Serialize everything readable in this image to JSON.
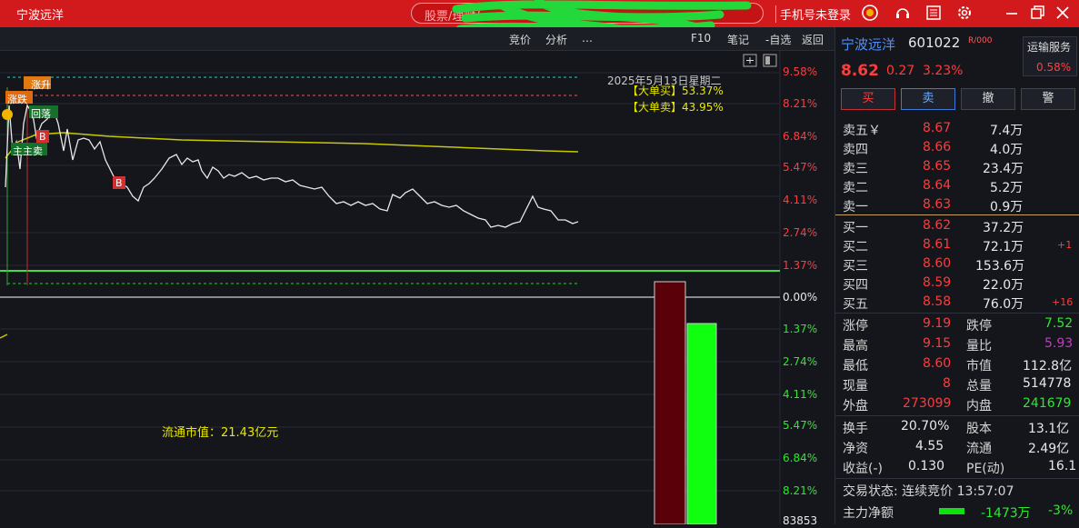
{
  "titlebar": {
    "title": "宁波远洋",
    "search_placeholder": "股票/理财/…",
    "login_label": "手机号未登录",
    "icons": [
      "gold-icon",
      "headset-icon",
      "notes-icon",
      "settings-icon",
      "minimize-icon",
      "restore-icon",
      "close-icon"
    ]
  },
  "toolbar": {
    "items": [
      "竞价",
      "分析",
      "…",
      "F10",
      "笔记",
      "-自选",
      "返回"
    ]
  },
  "chart": {
    "date_label": "2025年5月13日星期二",
    "big_buy_label": "【大单买】53.37%",
    "big_sell_label": "【大单卖】43.95%",
    "float_cap_label": "流通市值：21.43亿元",
    "markers": [
      "涨升",
      "涨跌",
      "回落",
      "B",
      "主主卖",
      "B"
    ],
    "right_axis_top": [
      "9.58%",
      "8.21%",
      "6.84%",
      "5.47%",
      "4.11%",
      "2.74%",
      "1.37%",
      "0.00%"
    ],
    "right_axis_bottom": [
      "1.37%",
      "2.74%",
      "4.11%",
      "5.47%",
      "6.84%",
      "8.21%",
      "83853"
    ],
    "colors": {
      "price_line": "#e8e8e8",
      "avg_line": "#c8c800",
      "sell_bar": "#5a0008",
      "buy_bar": "#0f0"
    }
  },
  "panel": {
    "name": "宁波远洋",
    "code": "601022",
    "sup": "R/000",
    "service_label": "运输服务",
    "service_pct": "0.58%",
    "price": "8.62",
    "change": "0.27",
    "change_pct": "3.23%",
    "trade_buttons": [
      "买",
      "卖",
      "撤",
      "警"
    ],
    "sell_rows": [
      {
        "label": "卖五￥",
        "price": "8.67",
        "vol": "7.4万",
        "delta": ""
      },
      {
        "label": "卖四",
        "price": "8.66",
        "vol": "4.0万",
        "delta": ""
      },
      {
        "label": "卖三",
        "price": "8.65",
        "vol": "23.4万",
        "delta": ""
      },
      {
        "label": "卖二",
        "price": "8.64",
        "vol": "5.2万",
        "delta": ""
      },
      {
        "label": "卖一",
        "price": "8.63",
        "vol": "0.9万",
        "delta": ""
      }
    ],
    "buy_rows": [
      {
        "label": "买一",
        "price": "8.62",
        "vol": "37.2万",
        "delta": ""
      },
      {
        "label": "买二",
        "price": "8.61",
        "vol": "72.1万",
        "delta": "+1"
      },
      {
        "label": "买三",
        "price": "8.60",
        "vol": "153.6万",
        "delta": ""
      },
      {
        "label": "买四",
        "price": "8.59",
        "vol": "22.0万",
        "delta": ""
      },
      {
        "label": "买五",
        "price": "8.58",
        "vol": "76.0万",
        "delta": "+16"
      }
    ],
    "stats": [
      {
        "l1": "涨停",
        "v1": "9.19",
        "c1": "red",
        "l2": "跌停",
        "v2": "7.52",
        "c2": "green"
      },
      {
        "l1": "最高",
        "v1": "9.15",
        "c1": "red",
        "l2": "量比",
        "v2": "5.93",
        "c2": "purple"
      },
      {
        "l1": "最低",
        "v1": "8.60",
        "c1": "red",
        "l2": "市值",
        "v2": "112.8亿",
        "c2": "white"
      },
      {
        "l1": "现量",
        "v1": "8",
        "c1": "red",
        "l2": "总量",
        "v2": "514778",
        "c2": "white"
      },
      {
        "l1": "外盘",
        "v1": "273099",
        "c1": "red",
        "l2": "内盘",
        "v2": "241679",
        "c2": "green"
      }
    ],
    "stats2": [
      {
        "l1": "换手",
        "v1": "20.70%",
        "l2": "股本",
        "v2": "13.1亿"
      },
      {
        "l1": "净资",
        "v1": "4.55",
        "l2": "流通",
        "v2": "2.49亿"
      },
      {
        "l1": "收益(-)",
        "v1": "0.130",
        "l2": "PE(动)",
        "v2": "16.1"
      }
    ],
    "trade_status": "交易状态: 连续竞价 13:57:07",
    "main_flow_label": "主力净额",
    "main_flow_value": "-1473万",
    "main_flow_pct": "-3%"
  }
}
